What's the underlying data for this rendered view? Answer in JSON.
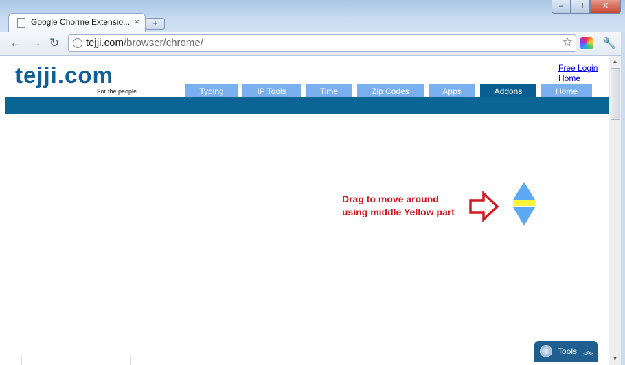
{
  "browser": {
    "tab_title": "Google Chorme Extensio...",
    "tab_close": "×",
    "new_tab": "+",
    "window_controls": {
      "minimize": "–",
      "maximize": "☐",
      "close": "✕"
    },
    "nav": {
      "back": "←",
      "forward": "→",
      "reload": "↻"
    },
    "url_host": "tejji.com",
    "url_path": "/browser/chrome/",
    "bookmark": "☆",
    "wrench": "🔧"
  },
  "site": {
    "logo": "tejji.com",
    "tagline": "For the people",
    "links": [
      "Free Login",
      "Home"
    ],
    "nav_tabs": [
      {
        "label": "Typing",
        "active": false
      },
      {
        "label": "IP Tools",
        "active": false
      },
      {
        "label": "Time",
        "active": false
      },
      {
        "label": "Zip Codes",
        "active": false
      },
      {
        "label": "Apps",
        "active": false
      },
      {
        "label": "Addons",
        "active": true
      },
      {
        "label": "Home",
        "active": false
      }
    ],
    "colors": {
      "brand": "#0a6595",
      "tab": "#7ab0ef",
      "tab_active": "#0a5f92",
      "callout": "#d4181e",
      "widget_blue": "#5aa9f2",
      "widget_yellow": "#fff23a"
    }
  },
  "content": {
    "callout_line1": "Drag to move around",
    "callout_line2": "using middle Yellow part"
  },
  "tools_widget": {
    "label": "Tools",
    "collapse": "︽"
  },
  "scrollbar": {
    "up": "▲",
    "down": "▼"
  }
}
